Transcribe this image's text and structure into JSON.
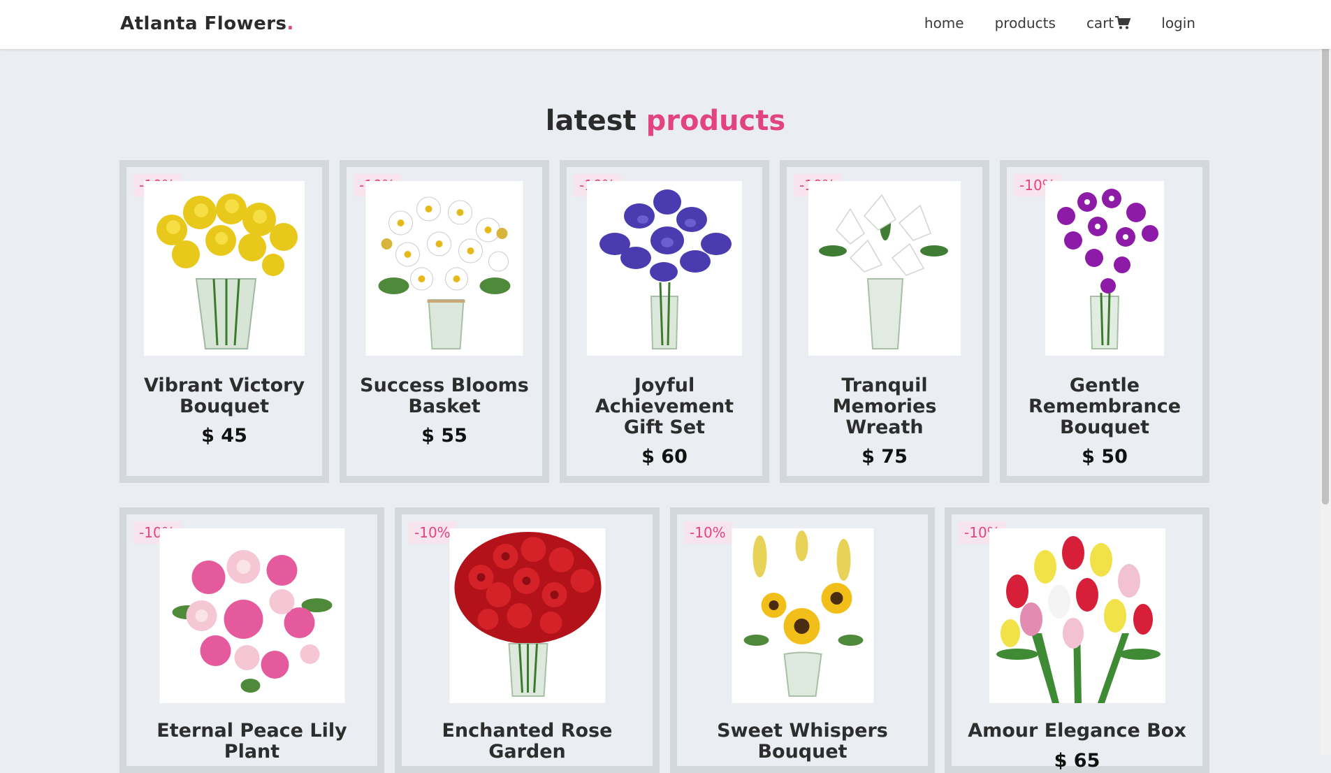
{
  "brand": {
    "name": "Atlanta Flowers",
    "dot": "."
  },
  "nav": {
    "home": "home",
    "products": "products",
    "cart": "cart",
    "login": "login"
  },
  "section": {
    "title_plain": "latest",
    "title_accent": "products"
  },
  "colors": {
    "accent": "#e2447f",
    "background": "#eaeef2",
    "card_border": "#d3d8dd"
  },
  "products": [
    {
      "name": "Vibrant Victory Bouquet",
      "price": "$ 45",
      "discount": "-10%",
      "image": "yellow-daffodil-bouquet"
    },
    {
      "name": "Success Blooms Basket",
      "price": "$ 55",
      "discount": "-10%",
      "image": "white-daisy-bouquet"
    },
    {
      "name": "Joyful Achievement Gift Set",
      "price": "$ 60",
      "discount": "-10%",
      "image": "purple-iris-bouquet"
    },
    {
      "name": "Tranquil Memories Wreath",
      "price": "$ 75",
      "discount": "-10%",
      "image": "white-lily-bouquet"
    },
    {
      "name": "Gentle Remembrance Bouquet",
      "price": "$ 50",
      "discount": "-10%",
      "image": "purple-orchid-bouquet"
    },
    {
      "name": "Eternal Peace Lily Plant",
      "price": "",
      "discount": "-10%",
      "image": "pink-peony-bouquet"
    },
    {
      "name": "Enchanted Rose Garden",
      "price": "",
      "discount": "-10%",
      "image": "red-rose-bouquet"
    },
    {
      "name": "Sweet Whispers Bouquet",
      "price": "",
      "discount": "-10%",
      "image": "sunflower-bouquet"
    },
    {
      "name": "Amour Elegance Box",
      "price": "$ 65",
      "discount": "-10%",
      "image": "tulip-bouquet"
    }
  ]
}
